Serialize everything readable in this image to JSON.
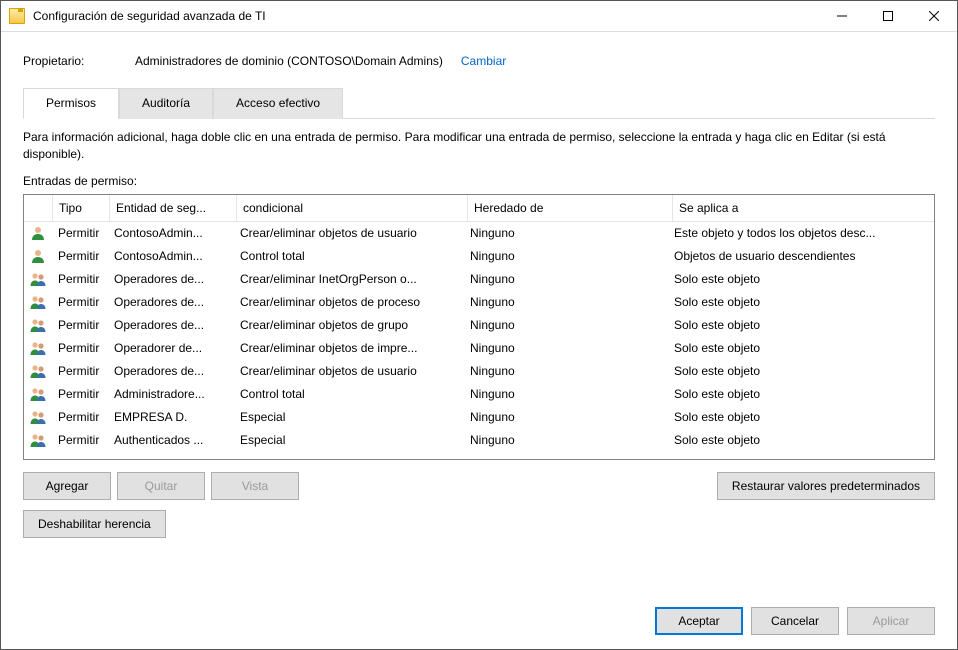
{
  "window": {
    "title": "Configuración de seguridad avanzada de TI",
    "min": "—",
    "max": "☐",
    "close": "✕"
  },
  "owner": {
    "label": "Propietario:",
    "value": "Administradores de dominio (CONTOSO\\Domain Admins)",
    "change": "Cambiar"
  },
  "tabs": {
    "permissions": "Permisos",
    "auditing": "Auditoría",
    "effective": "Acceso efectivo"
  },
  "infotext": "Para información adicional, haga doble clic en una entrada de permiso. Para modificar una entrada de permiso, seleccione la entrada y haga clic en Editar (si está disponible).",
  "entries_label": "Entradas de permiso:",
  "columns": {
    "type": "Tipo",
    "principal": "Entidad de seg...",
    "access": "condicional",
    "inherited": "Heredado de",
    "applies": "Se aplica a"
  },
  "rows": [
    {
      "icon": "user",
      "type": "Permitir",
      "principal": "ContosoAdmin...",
      "access": "Crear/eliminar objetos de usuario",
      "inherited": "Ninguno",
      "applies": "Este objeto y todos los objetos desc..."
    },
    {
      "icon": "user",
      "type": "Permitir",
      "principal": "ContosoAdmin...",
      "access": "Control total",
      "inherited": "Ninguno",
      "applies": "Objetos de usuario descendientes"
    },
    {
      "icon": "group",
      "type": "Permitir",
      "principal": "Operadores de...",
      "access": "Crear/eliminar InetOrgPerson o...",
      "inherited": "Ninguno",
      "applies": "Solo este objeto"
    },
    {
      "icon": "group",
      "type": "Permitir",
      "principal": "Operadores de...",
      "access": "Crear/eliminar objetos de proceso",
      "inherited": "Ninguno",
      "applies": "Solo este objeto"
    },
    {
      "icon": "group",
      "type": "Permitir",
      "principal": "Operadores de...",
      "access": "Crear/eliminar objetos de grupo",
      "inherited": "Ninguno",
      "applies": "Solo este objeto"
    },
    {
      "icon": "group",
      "type": "Permitir",
      "principal": "Operadorer de...",
      "access": "Crear/eliminar objetos de impre...",
      "inherited": "Ninguno",
      "applies": "Solo este objeto"
    },
    {
      "icon": "group",
      "type": "Permitir",
      "principal": "Operadores de...",
      "access": "Crear/eliminar objetos de usuario",
      "inherited": "Ninguno",
      "applies": "Solo este objeto"
    },
    {
      "icon": "group",
      "type": "Permitir",
      "principal": "Administradore...",
      "access": "Control total",
      "inherited": "Ninguno",
      "applies": "Solo este objeto"
    },
    {
      "icon": "group",
      "type": "Permitir",
      "principal": "EMPRESA D.",
      "access": "Especial",
      "inherited": "Ninguno",
      "applies": "Solo este objeto"
    },
    {
      "icon": "group",
      "type": "Permitir",
      "principal": "Authenticados ...",
      "access": "Especial",
      "inherited": "Ninguno",
      "applies": "Solo este objeto"
    }
  ],
  "buttons": {
    "add": "Agregar",
    "remove": "Quitar",
    "view": "Vista",
    "restore": "Restaurar valores predeterminados",
    "disable_inheritance": "Deshabilitar herencia",
    "ok": "Aceptar",
    "cancel": "Cancelar",
    "apply": "Aplicar"
  }
}
